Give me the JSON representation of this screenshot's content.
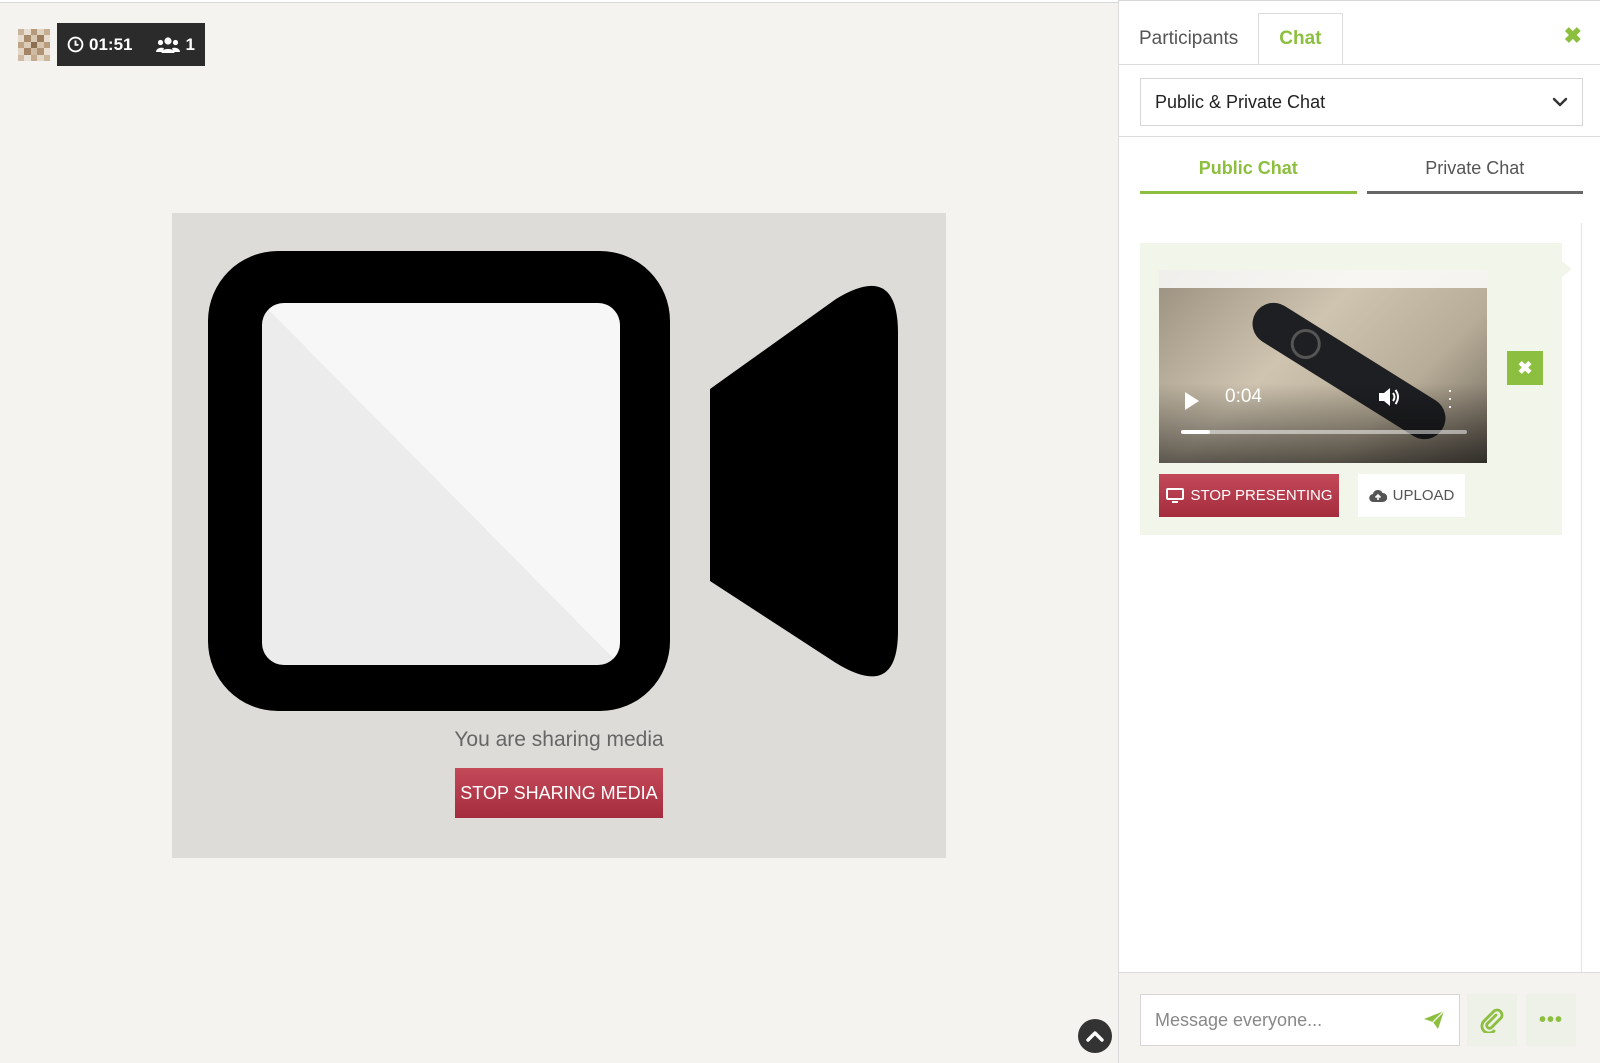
{
  "status": {
    "timer": "01:51",
    "participants_count": "1"
  },
  "main": {
    "sharing_text": "You are sharing media",
    "stop_sharing_label": "STOP SHARING MEDIA"
  },
  "sidebar": {
    "tabs": [
      {
        "label": "Participants",
        "active": false
      },
      {
        "label": "Chat",
        "active": true
      }
    ],
    "chat_mode_select": "Public & Private Chat",
    "sub_tabs": [
      {
        "label": "Public Chat",
        "active": true
      },
      {
        "label": "Private Chat",
        "active": false
      }
    ],
    "message": {
      "video_time": "0:04",
      "video_progress": 0.1,
      "stop_presenting_label": "STOP PRESENTING",
      "upload_label": "UPLOAD"
    },
    "composer": {
      "placeholder": "Message everyone..."
    }
  },
  "colors": {
    "accent": "#8cbf3f",
    "danger": "#b23a4a",
    "dark": "#2b2b2b"
  }
}
